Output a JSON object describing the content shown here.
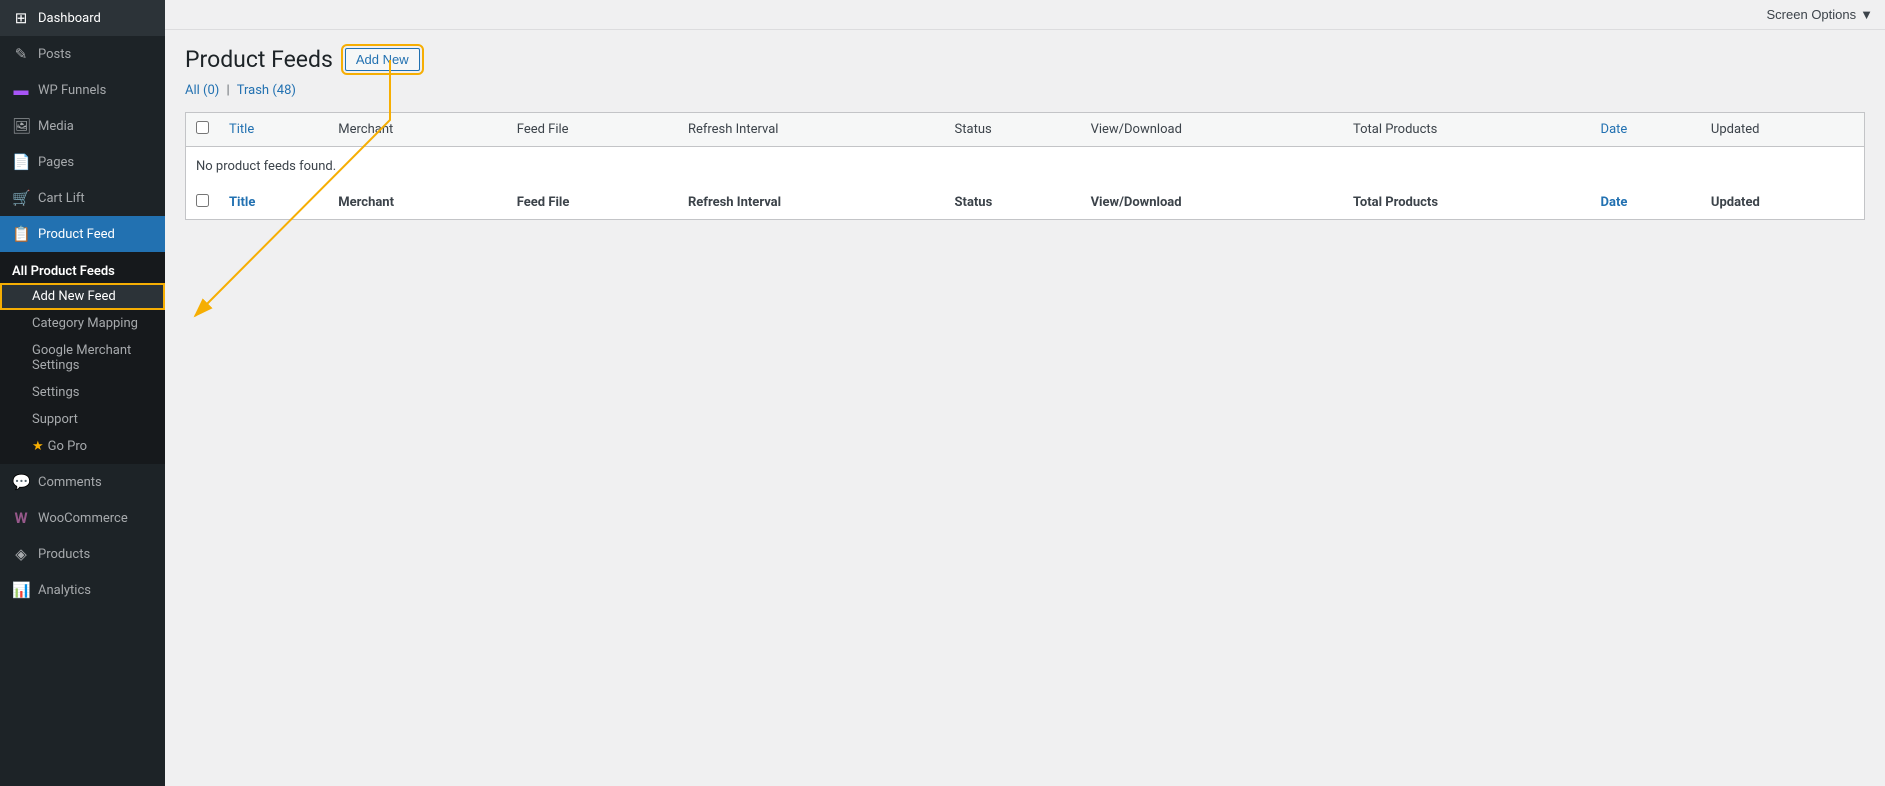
{
  "sidebar": {
    "items": [
      {
        "id": "dashboard",
        "label": "Dashboard",
        "icon": "⊞",
        "active": false
      },
      {
        "id": "posts",
        "label": "Posts",
        "icon": "✎",
        "active": false
      },
      {
        "id": "wp-funnels",
        "label": "WP Funnels",
        "icon": "≡",
        "active": false
      },
      {
        "id": "media",
        "label": "Media",
        "icon": "🖼",
        "active": false
      },
      {
        "id": "pages",
        "label": "Pages",
        "icon": "📄",
        "active": false
      },
      {
        "id": "cart-lift",
        "label": "Cart Lift",
        "icon": "🛒",
        "active": false
      },
      {
        "id": "product-feed",
        "label": "Product Feed",
        "icon": "📋",
        "active": true
      },
      {
        "id": "comments",
        "label": "Comments",
        "icon": "💬",
        "active": false
      },
      {
        "id": "woocommerce",
        "label": "WooCommerce",
        "icon": "W",
        "active": false
      },
      {
        "id": "products",
        "label": "Products",
        "icon": "◈",
        "active": false
      },
      {
        "id": "analytics",
        "label": "Analytics",
        "icon": "📊",
        "active": false
      }
    ],
    "submenu": {
      "section_title": "All Product Feeds",
      "items": [
        {
          "id": "add-new-feed",
          "label": "Add New Feed",
          "active": false,
          "highlighted": true
        },
        {
          "id": "category-mapping",
          "label": "Category Mapping",
          "active": false
        },
        {
          "id": "google-merchant-settings",
          "label": "Google Merchant Settings",
          "active": false
        },
        {
          "id": "settings",
          "label": "Settings",
          "active": false
        },
        {
          "id": "support",
          "label": "Support",
          "active": false
        },
        {
          "id": "go-pro",
          "label": "Go Pro",
          "active": false,
          "star": true
        }
      ]
    }
  },
  "topbar": {
    "screen_options_label": "Screen Options",
    "dropdown_icon": "▼"
  },
  "header": {
    "title": "Product Feeds",
    "add_new_label": "Add New"
  },
  "filters": {
    "all_label": "All (0)",
    "trash_label": "Trash (48)"
  },
  "table": {
    "columns": [
      {
        "id": "cb",
        "label": "",
        "type": "checkbox"
      },
      {
        "id": "title",
        "label": "Title",
        "sortable": true
      },
      {
        "id": "merchant",
        "label": "Merchant"
      },
      {
        "id": "feed-file",
        "label": "Feed File"
      },
      {
        "id": "refresh-interval",
        "label": "Refresh Interval"
      },
      {
        "id": "status",
        "label": "Status"
      },
      {
        "id": "view-download",
        "label": "View/Download"
      },
      {
        "id": "total-products",
        "label": "Total Products"
      },
      {
        "id": "date",
        "label": "Date",
        "sortable": true
      },
      {
        "id": "updated",
        "label": "Updated"
      }
    ],
    "empty_message": "No product feeds found.",
    "rows": []
  }
}
